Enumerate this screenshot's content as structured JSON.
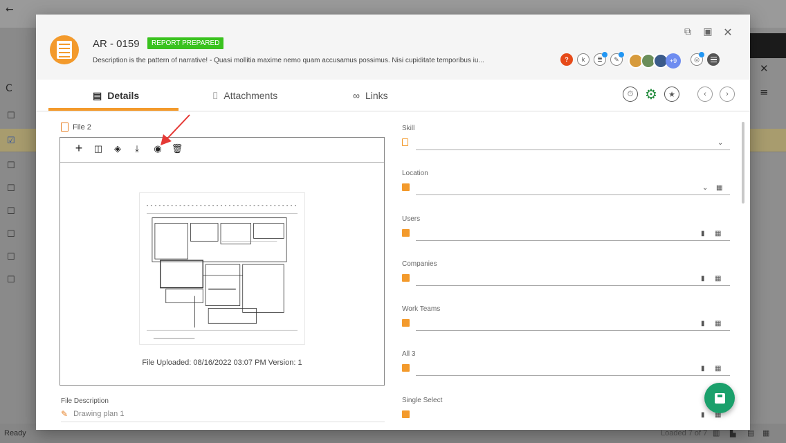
{
  "background": {
    "footer_status": "Ready",
    "footer_loaded": "Loaded 7 of 7"
  },
  "header": {
    "report_id": "AR - 0159",
    "status_badge": "REPORT PREPARED",
    "description": "Description is the pattern of narrative! - Quasi mollitia maxime nemo quam accusamus possimus. Nisi cupiditate temporibus iu...",
    "more_avatars": "+9",
    "help_icon": "?"
  },
  "tabs": [
    {
      "label": "Details",
      "icon": "details-icon"
    },
    {
      "label": "Attachments",
      "icon": "paperclip-icon"
    },
    {
      "label": "Links",
      "icon": "link-icon"
    }
  ],
  "file_section": {
    "title": "File 2",
    "uploaded_text": "File Uploaded: 08/16/2022  03:07 PM  Version: 1",
    "description_label": "File Description",
    "description_value": "Drawing plan 1"
  },
  "fields": [
    {
      "label": "Skill"
    },
    {
      "label": "Location"
    },
    {
      "label": "Users"
    },
    {
      "label": "Companies"
    },
    {
      "label": "Work Teams"
    },
    {
      "label": "All 3"
    },
    {
      "label": "Single Select"
    }
  ],
  "colors": {
    "accent": "#f39a2c",
    "badge": "#39c21e",
    "fab": "#1aa06b",
    "arrow": "#e53935"
  }
}
